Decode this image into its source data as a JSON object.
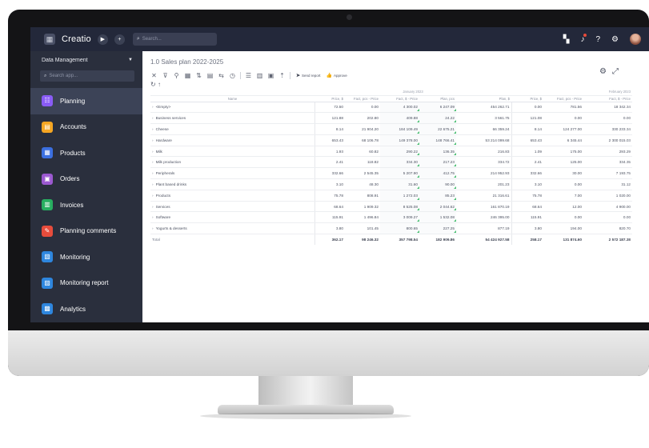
{
  "topbar": {
    "logo": "Creatio",
    "search_placeholder": "Search...",
    "icons": [
      "apps-grid-icon",
      "play-icon",
      "add-icon",
      "search-icon",
      "launch-icon",
      "notification-bell-icon",
      "help-icon",
      "settings-gear-icon",
      "user-avatar"
    ]
  },
  "sidebar": {
    "workspace": "Data Management",
    "search_placeholder": "Search app...",
    "items": [
      {
        "label": "Planning",
        "icon": "planning-icon",
        "color": "#8a5cf5",
        "active": true
      },
      {
        "label": "Accounts",
        "icon": "accounts-icon",
        "color": "#f5a623"
      },
      {
        "label": "Products",
        "icon": "products-icon",
        "color": "#3b6fe0"
      },
      {
        "label": "Orders",
        "icon": "orders-icon",
        "color": "#9b59d0"
      },
      {
        "label": "Invoices",
        "icon": "invoices-icon",
        "color": "#27ae60"
      },
      {
        "label": "Planning comments",
        "icon": "planning-comments-icon",
        "color": "#e74c3c"
      },
      {
        "label": "Monitoring",
        "icon": "monitoring-icon",
        "color": "#2e86de"
      },
      {
        "label": "Monitoring report",
        "icon": "monitoring-report-icon",
        "color": "#2e86de"
      },
      {
        "label": "Analytics",
        "icon": "analytics-icon",
        "color": "#2e86de"
      }
    ]
  },
  "content": {
    "title": "1.0 Sales plan 2022-2025",
    "toolbar": {
      "send_report": "Send report",
      "approve": "Approve"
    },
    "pivot": {
      "group_headers": [
        "January 2023",
        "February 2023"
      ],
      "columns": [
        "Name",
        "Price, $",
        "Fact, pcs - Price",
        "Fact, $ - Price",
        "Plan, pcs",
        "Plan, $",
        "Price, $",
        "Fact, pcs - Price",
        "Fact, $ - Price"
      ],
      "rows": [
        {
          "name": "<Empty>",
          "values": [
            "72.50",
            "0.00",
            "4 300.02",
            "6 247.09",
            "454 262.71",
            "0.00",
            "781.56",
            "18 342.34"
          ]
        },
        {
          "name": "Business services",
          "values": [
            "121.88",
            "202.80",
            "409.88",
            "24.22",
            "3 561.75",
            "121.08",
            "0.00",
            "0.00"
          ]
        },
        {
          "name": "Cheese",
          "values": [
            "8.14",
            "21 904.20",
            "184 109.49",
            "22 675.21",
            "66 359.24",
            "8.14",
            "124 277.00",
            "330 233.34"
          ]
        },
        {
          "name": "Hardware",
          "values": [
            "653.43",
            "68 106.78",
            "149 378.00",
            "148 766.41",
            "53 214 099.68",
            "653.43",
            "6 345.44",
            "2 300 015.03"
          ]
        },
        {
          "name": "Milk",
          "values": [
            "1.93",
            "60.82",
            "290.22",
            "136.35",
            "216.83",
            "1.09",
            "175.00",
            "293.29"
          ]
        },
        {
          "name": "Milk production",
          "values": [
            "2.41",
            "118.82",
            "334.30",
            "217.23",
            "334.72",
            "2.41",
            "125.00",
            "334.35"
          ]
        },
        {
          "name": "Peripherals",
          "values": [
            "332.66",
            "2 545.35",
            "5 207.90",
            "412.75",
            "214 952.93",
            "332.66",
            "30.00",
            "7 193.75"
          ]
        },
        {
          "name": "Plant based drinks",
          "values": [
            "3.10",
            "48.30",
            "31.60",
            "90.00",
            "201.23",
            "3.10",
            "0.00",
            "31.12"
          ]
        },
        {
          "name": "Products",
          "values": [
            "75.78",
            "808.91",
            "1 272.03",
            "85.23",
            "21 316.61",
            "75.78",
            "7.00",
            "1 020.00"
          ]
        },
        {
          "name": "Services",
          "values": [
            "68.64",
            "1 909.32",
            "8 525.08",
            "2 044.62",
            "161 870.19",
            "68.64",
            "12.00",
            "4 900.00"
          ]
        },
        {
          "name": "Software",
          "values": [
            "115.91",
            "1 496.84",
            "3 009.27",
            "1 532.08",
            "246 395.00",
            "115.91",
            "0.00",
            "0.00"
          ]
        },
        {
          "name": "Yogurts & desserts",
          "values": [
            "3.80",
            "101.45",
            "800.65",
            "227.25",
            "877.19",
            "3.80",
            "194.00",
            "820.70"
          ]
        }
      ],
      "total": {
        "name": "Total",
        "values": [
          "362.17",
          "98 246.32",
          "357 798.54",
          "182 909.86",
          "54 424 927.58",
          "258.17",
          "131 874.60",
          "2 572 187.38"
        ]
      }
    }
  }
}
